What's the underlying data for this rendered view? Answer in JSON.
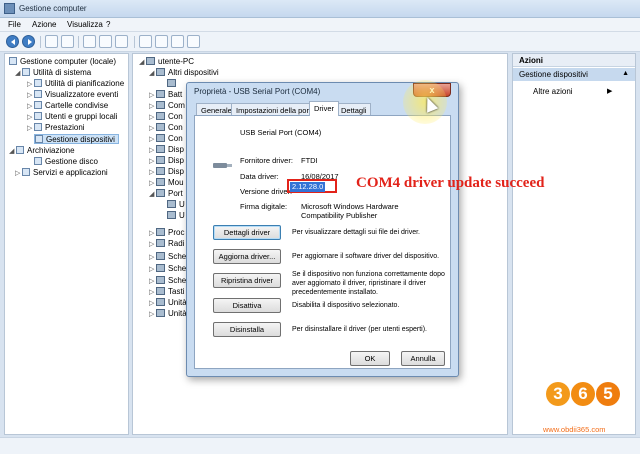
{
  "window": {
    "title": "Gestione computer"
  },
  "menu": [
    "File",
    "Azione",
    "Visualizza",
    "?"
  ],
  "left_tree": [
    {
      "label": "Gestione computer (locale)",
      "level": 0
    },
    {
      "label": "Utilità di sistema",
      "level": 1
    },
    {
      "label": "Utilità di pianificazione",
      "level": 2
    },
    {
      "label": "Visualizzatore eventi",
      "level": 2
    },
    {
      "label": "Cartelle condivise",
      "level": 2
    },
    {
      "label": "Utenti e gruppi locali",
      "level": 2
    },
    {
      "label": "Prestazioni",
      "level": 2
    },
    {
      "label": "Gestione dispositivi",
      "level": 2
    },
    {
      "label": "Archiviazione",
      "level": 1
    },
    {
      "label": "Gestione disco",
      "level": 2
    },
    {
      "label": "Servizi e applicazioni",
      "level": 1
    }
  ],
  "device_tree": {
    "root": "utente-PC",
    "items": [
      "Altri dispositivi",
      "Batt",
      "Com",
      "Con",
      "Con",
      "Con",
      "Disp",
      "Disp",
      "Disp",
      "Mou",
      "Port",
      "U",
      "U",
      "Proc",
      "Radi",
      "Sche",
      "Sche",
      "Sche",
      "Tasti",
      "Unità",
      "Unità"
    ]
  },
  "actions": {
    "header": "Azioni",
    "section": "Gestione dispositivi",
    "item": "Altre azioni"
  },
  "dialog": {
    "title": "Proprietà - USB Serial Port (COM4)",
    "close_label": "x",
    "tabs": [
      "Generale",
      "Impostazioni della porta",
      "Driver",
      "Dettagli"
    ],
    "device_name": "USB Serial Port (COM4)",
    "fields": [
      {
        "label": "Fornitore driver:",
        "value": "FTDI"
      },
      {
        "label": "Data driver:",
        "value": "16/08/2017"
      },
      {
        "label": "Versione driver:",
        "value": "2.12.28.0"
      },
      {
        "label": "Firma digitale:",
        "value": "Microsoft Windows Hardware Compatibility Publisher"
      }
    ],
    "buttons": [
      {
        "label": "Dettagli driver",
        "desc": "Per visualizzare dettagli sui file dei driver."
      },
      {
        "label": "Aggiorna driver...",
        "desc": "Per aggiornare il software driver del dispositivo."
      },
      {
        "label": "Ripristina driver",
        "desc": "Se il dispositivo non funziona correttamente dopo aver aggiornato il driver, ripristinare il driver precedentemente installato."
      },
      {
        "label": "Disattiva",
        "desc": "Disabilita il dispositivo selezionato."
      },
      {
        "label": "Disinstalla",
        "desc": "Per disinstallare il driver (per utenti esperti)."
      }
    ],
    "ok_label": "OK",
    "cancel_label": "Annulla"
  },
  "overlay_text": "COM4 driver update succeed",
  "watermark": {
    "digits": [
      "3",
      "6",
      "5"
    ],
    "url": "www.obdii365.com"
  }
}
